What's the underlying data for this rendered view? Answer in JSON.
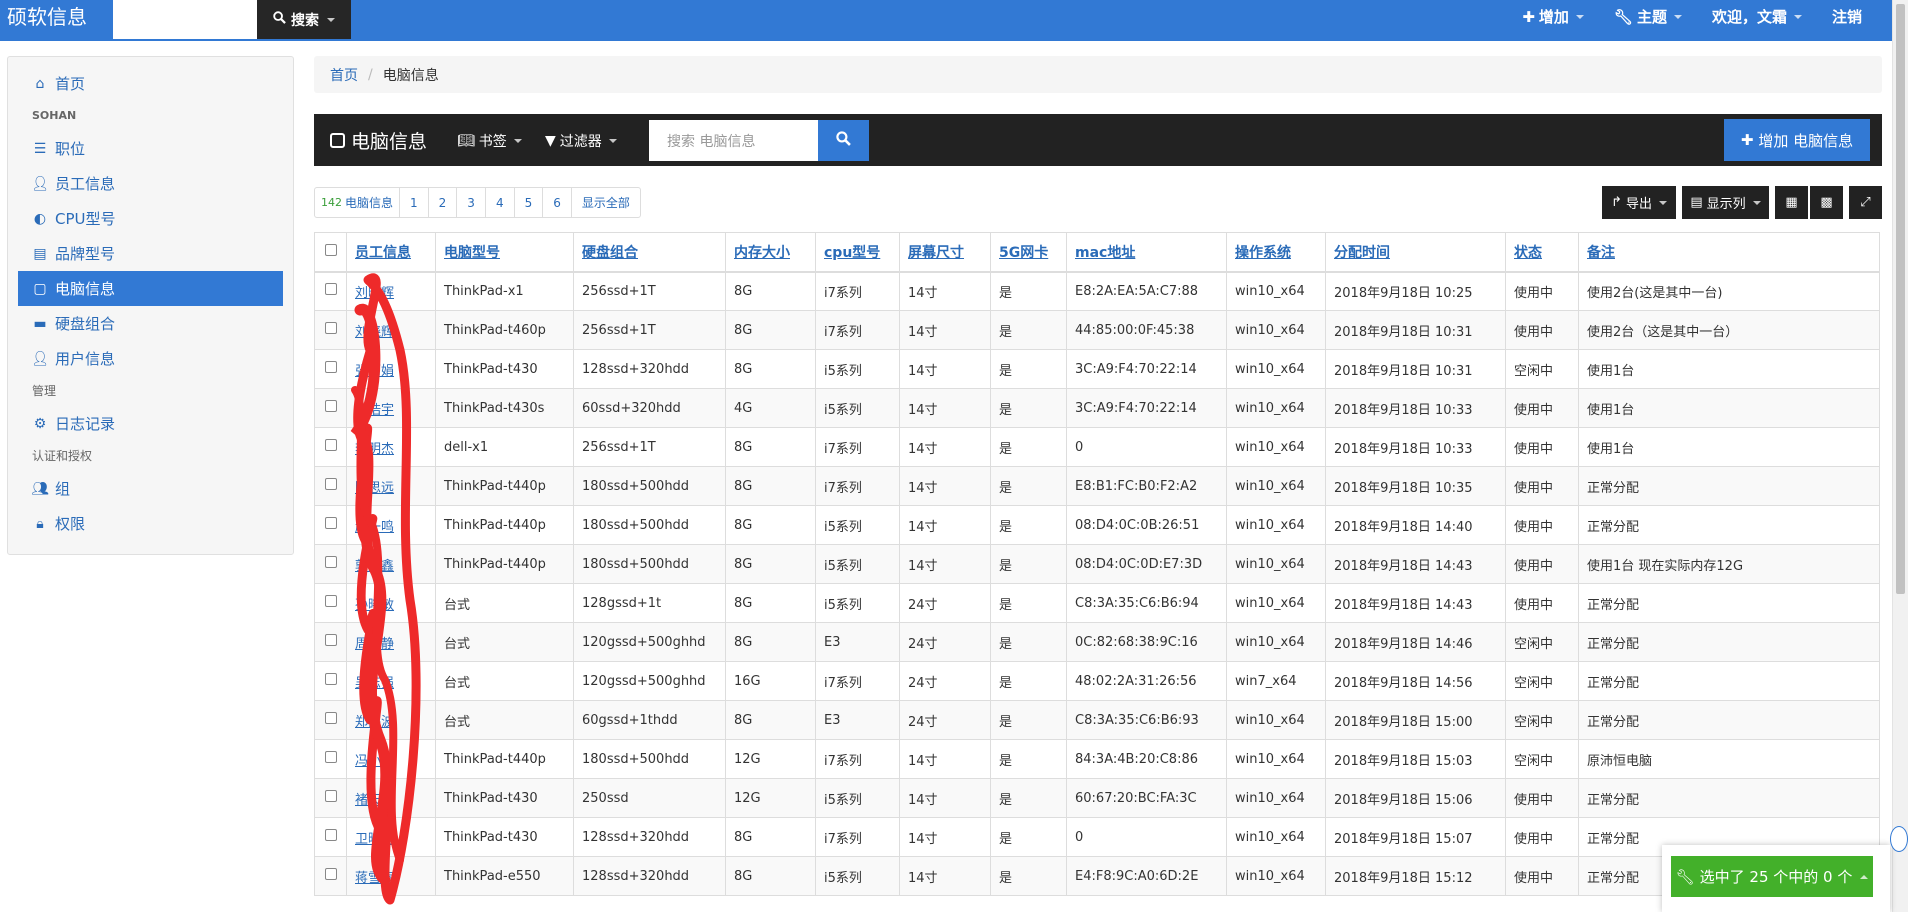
{
  "topnav": {
    "brand": "硕软信息",
    "search_label": "搜索",
    "add_label": "增加",
    "theme_label": "主题",
    "welcome_label": "欢迎，文霜",
    "logout_label": "注销"
  },
  "sidebar": {
    "home": "首页",
    "section_sohan": "SOHAN",
    "items": [
      "职位",
      "员工信息",
      "CPU型号",
      "品牌型号",
      "电脑信息",
      "硬盘组合",
      "用户信息"
    ],
    "section_admin": "管理",
    "log": "日志记录",
    "section_auth": "认证和授权",
    "group": "组",
    "perm": "权限"
  },
  "breadcrumb": {
    "home": "首页",
    "current": "电脑信息"
  },
  "toolbar": {
    "title": "电脑信息",
    "bookmark": "书签",
    "filter": "过滤器",
    "search_placeholder": "搜索 电脑信息",
    "add_button": "增加 电脑信息"
  },
  "pager": {
    "count": "142",
    "count_label": "电脑信息",
    "pages": [
      "1",
      "2",
      "3",
      "4",
      "5",
      "6"
    ],
    "show_all": "显示全部"
  },
  "tools": {
    "export": "导出",
    "columns": "显示列"
  },
  "table": {
    "headers": [
      "员工信息",
      "电脑型号",
      "硬盘组合",
      "内存大小",
      "cpu型号",
      "屏幕尺寸",
      "5G网卡",
      "mac地址",
      "操作系统",
      "分配时间",
      "状态",
      "备注"
    ],
    "rows": [
      [
        "刘晓辉",
        "ThinkPad-x1",
        "256ssd+1T",
        "8G",
        "i7系列",
        "14寸",
        "是",
        "E8:2A:EA:5A:C7:88",
        "win10_x64",
        "2018年9月18日 10:25",
        "使用中",
        "使用2台(这是其中一台)"
      ],
      [
        "刘晓辉",
        "ThinkPad-t460p",
        "256ssd+1T",
        "8G",
        "i7系列",
        "14寸",
        "是",
        "44:85:00:0F:45:38",
        "win10_x64",
        "2018年9月18日 10:31",
        "使用中",
        "使用2台（这是其中一台）"
      ],
      [
        "张丽娟",
        "ThinkPad-t430",
        "128ssd+320hdd",
        "8G",
        "i5系列",
        "14寸",
        "是",
        "3C:A9:F4:70:22:14",
        "win10_x64",
        "2018年9月18日 10:31",
        "空闲中",
        "使用1台"
      ],
      [
        "王浩宇",
        "ThinkPad-t430s",
        "60ssd+320hdd",
        "4G",
        "i5系列",
        "14寸",
        "是",
        "3C:A9:F4:70:22:14",
        "win10_x64",
        "2018年9月18日 10:33",
        "使用中",
        "使用1台"
      ],
      [
        "李明杰",
        "dell-x1",
        "256ssd+1T",
        "8G",
        "i7系列",
        "14寸",
        "是",
        "0",
        "win10_x64",
        "2018年9月18日 10:33",
        "使用中",
        "使用1台"
      ],
      [
        "陈思远",
        "ThinkPad-t440p",
        "180ssd+500hdd",
        "8G",
        "i7系列",
        "14寸",
        "是",
        "E8:B1:FC:B0:F2:A2",
        "win10_x64",
        "2018年9月18日 10:35",
        "使用中",
        "正常分配"
      ],
      [
        "赵一鸣",
        "ThinkPad-t440p",
        "180ssd+500hdd",
        "8G",
        "i5系列",
        "14寸",
        "是",
        "08:D4:0C:0B:26:51",
        "win10_x64",
        "2018年9月18日 14:40",
        "使用中",
        "正常分配"
      ],
      [
        "郭嘉鑫",
        "ThinkPad-t440p",
        "180ssd+500hdd",
        "8G",
        "i5系列",
        "14寸",
        "是",
        "08:D4:0C:0D:E7:3D",
        "win10_x64",
        "2018年9月18日 14:43",
        "使用中",
        "使用1台 现在实际内存12G"
      ],
      [
        "孙晓敏",
        "台式",
        "128gssd+1t",
        "8G",
        "i5系列",
        "24寸",
        "是",
        "C8:3A:35:C6:B6:94",
        "win10_x64",
        "2018年9月18日 14:43",
        "使用中",
        "正常分配"
      ],
      [
        "周文静",
        "台式",
        "120gssd+500ghhd",
        "8G",
        "E3",
        "24寸",
        "是",
        "0C:82:68:38:9C:16",
        "win10_x64",
        "2018年9月18日 14:46",
        "空闲中",
        "正常分配"
      ],
      [
        "吴志强",
        "台式",
        "120gssd+500ghhd",
        "16G",
        "i7系列",
        "24寸",
        "是",
        "48:02:2A:31:26:56",
        "win7_x64",
        "2018年9月18日 14:56",
        "空闲中",
        "正常分配"
      ],
      [
        "郑海波",
        "台式",
        "60gssd+1thdd",
        "8G",
        "E3",
        "24寸",
        "是",
        "C8:3A:35:C6:B6:93",
        "win10_x64",
        "2018年9月18日 15:00",
        "空闲中",
        "正常分配"
      ],
      [
        "冯小松",
        "ThinkPad-t440p",
        "180ssd+500hdd",
        "12G",
        "i7系列",
        "14寸",
        "是",
        "84:3A:4B:20:C8:86",
        "win10_x64",
        "2018年9月18日 15:03",
        "空闲中",
        "原沛恒电脑"
      ],
      [
        "褚天一",
        "ThinkPad-t430",
        "250ssd",
        "12G",
        "i5系列",
        "14寸",
        "是",
        "60:67:20:BC:FA:3C",
        "win10_x64",
        "2018年9月18日 15:06",
        "使用中",
        "正常分配"
      ],
      [
        "卫晓蕾",
        "ThinkPad-t430",
        "128ssd+320hdd",
        "8G",
        "i7系列",
        "14寸",
        "是",
        "0",
        "win10_x64",
        "2018年9月18日 15:07",
        "使用中",
        "正常分配"
      ],
      [
        "蒋雪梅",
        "ThinkPad-e550",
        "128ssd+320hdd",
        "8G",
        "i5系列",
        "14寸",
        "是",
        "E4:F8:9C:A0:6D:2E",
        "win10_x64",
        "2018年9月18日 15:12",
        "使用中",
        "正常分配"
      ]
    ]
  },
  "selection": {
    "label": "选中了 25 个中的 0 个"
  },
  "colors": {
    "primary": "#3279d4",
    "toolbar": "#222222",
    "success": "#43b02a",
    "scribble": "#ee2a2a"
  },
  "icons": [
    "search-icon",
    "plus-icon",
    "wrench-icon",
    "home-icon",
    "list-icon",
    "user-icon",
    "half-circle-icon",
    "id-card-icon",
    "monitor-icon",
    "drive-icon",
    "gear-icon",
    "users-icon",
    "lock-icon",
    "book-icon",
    "filter-icon",
    "share-icon",
    "table-icon",
    "grid-icon",
    "expand-icon"
  ]
}
